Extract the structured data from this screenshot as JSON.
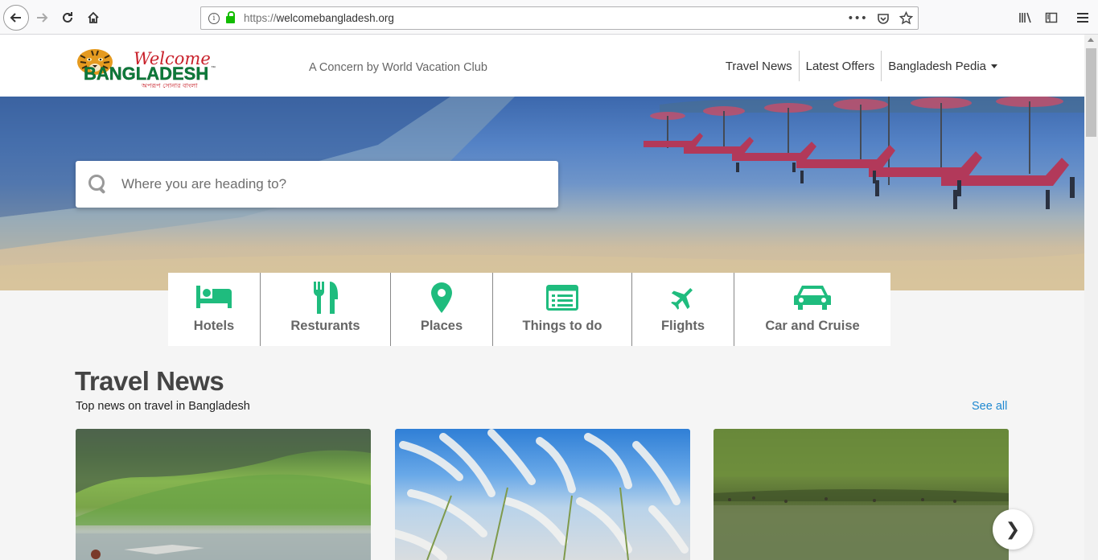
{
  "browser": {
    "url_scheme": "https://",
    "url_host": "welcomebangladesh.org"
  },
  "header": {
    "logo_text_top": "Welcome",
    "logo_text_main": "BANGLADESH",
    "logo_text_bengali": "অপরূপ সোনার বাংলা",
    "tagline": "A Concern by World Vacation Club",
    "nav": {
      "travel_news": "Travel News",
      "latest_offers": "Latest Offers",
      "bangladesh_pedia": "Bangladesh Pedia"
    }
  },
  "hero": {
    "search_placeholder": "Where you are heading to?"
  },
  "categories": [
    {
      "label": "Hotels",
      "icon": "bed-icon"
    },
    {
      "label": "Resturants",
      "icon": "cutlery-icon"
    },
    {
      "label": "Places",
      "icon": "map-marker-icon"
    },
    {
      "label": "Things to do",
      "icon": "list-icon"
    },
    {
      "label": "Flights",
      "icon": "plane-icon"
    },
    {
      "label": "Car and Cruise",
      "icon": "car-icon"
    }
  ],
  "travel_news": {
    "title": "Travel News",
    "subtitle": "Top news on travel in Bangladesh",
    "see_all": "See all",
    "next_glyph": "❯"
  },
  "colors": {
    "accent_green": "#1fbc7e",
    "link_blue": "#1e88d0"
  }
}
